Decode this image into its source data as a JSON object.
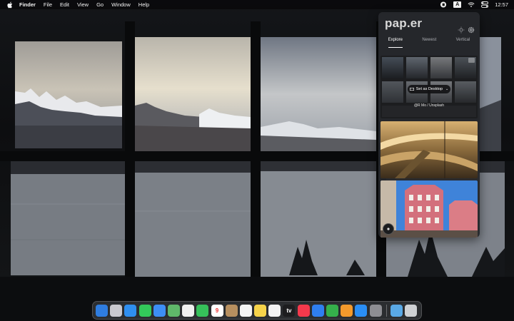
{
  "menubar": {
    "apple_icon": "apple-icon",
    "app_name": "Finder",
    "items": [
      "File",
      "Edit",
      "View",
      "Go",
      "Window",
      "Help"
    ],
    "status_icons": [
      "paper-app-icon",
      "input-source-icon",
      "wifi-icon",
      "control-center-icon"
    ],
    "input_source": "A",
    "clock": "12:57"
  },
  "paper": {
    "logo": "pap.er",
    "header_icons": [
      "brightness-icon",
      "settings-icon"
    ],
    "tabs": [
      {
        "label": "Explore",
        "active": true
      },
      {
        "label": "Newest",
        "active": false
      },
      {
        "label": "Vertical",
        "active": false
      }
    ],
    "tiles": [
      {
        "description": "grid of thumbnails",
        "set_desktop_label": "Set as Desktop",
        "credit": "@R Mo / Unsplash"
      },
      {
        "description": "highway at sunset"
      },
      {
        "description": "pink building against blue sky"
      }
    ]
  },
  "dock": {
    "apps": [
      {
        "name": "finder",
        "icon": "finder-icon",
        "color": "#2f7de1"
      },
      {
        "name": "launchpad",
        "icon": "launchpad-icon",
        "color": "#c9c9cf"
      },
      {
        "name": "safari",
        "icon": "safari-icon",
        "color": "#2f8ff0"
      },
      {
        "name": "messages",
        "icon": "messages-icon",
        "color": "#33c95a"
      },
      {
        "name": "mail",
        "icon": "mail-icon",
        "color": "#3d8ef5"
      },
      {
        "name": "maps",
        "icon": "maps-icon",
        "color": "#5fb86a"
      },
      {
        "name": "photos",
        "icon": "photos-icon",
        "color": "#f0f0f0"
      },
      {
        "name": "facetime",
        "icon": "facetime-icon",
        "color": "#36c05a"
      },
      {
        "name": "calendar",
        "icon": "calendar-icon",
        "color": "#ffffff",
        "text": "9"
      },
      {
        "name": "contacts",
        "icon": "contacts-icon",
        "color": "#b78f5f"
      },
      {
        "name": "reminders",
        "icon": "reminders-icon",
        "color": "#f4f4f4"
      },
      {
        "name": "notes",
        "icon": "notes-icon",
        "color": "#f6d34a"
      },
      {
        "name": "freeform",
        "icon": "freeform-icon",
        "color": "#f2f2f2"
      },
      {
        "name": "tv",
        "icon": "appletv-icon",
        "color": "#1d1d1f",
        "text": "tv"
      },
      {
        "name": "music",
        "icon": "music-icon",
        "color": "#f5394c"
      },
      {
        "name": "keynote",
        "icon": "keynote-icon",
        "color": "#2f7ff0"
      },
      {
        "name": "numbers",
        "icon": "numbers-icon",
        "color": "#35b04b"
      },
      {
        "name": "pages",
        "icon": "pages-icon",
        "color": "#f39a2c"
      },
      {
        "name": "app-store",
        "icon": "app-store-icon",
        "color": "#2a8ef5"
      },
      {
        "name": "system-settings",
        "icon": "settings-icon",
        "color": "#8e8e93"
      }
    ],
    "trailing": [
      {
        "name": "downloads",
        "icon": "downloads-folder-icon",
        "color": "#5aa9e6"
      },
      {
        "name": "trash",
        "icon": "trash-icon",
        "color": "#cfd1d4"
      }
    ]
  }
}
